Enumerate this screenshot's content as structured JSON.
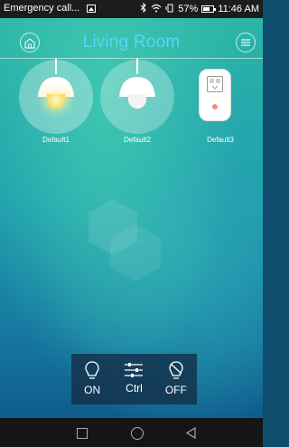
{
  "status_bar": {
    "notification_text": "Emergency call...",
    "battery_percent": "57%",
    "time": "11:46 AM",
    "icons": [
      "image-icon",
      "bluetooth-icon",
      "wifi-icon",
      "vibrate-icon",
      "battery-icon"
    ]
  },
  "header": {
    "title": "Living Room",
    "left_icon": "home-icon",
    "right_icon": "menu-icon"
  },
  "devices": [
    {
      "name": "Default1",
      "type": "lamp",
      "state": "on"
    },
    {
      "name": "Default2",
      "type": "lamp",
      "state": "off"
    },
    {
      "name": "Default3",
      "type": "smart-plug",
      "state": "off"
    }
  ],
  "controls": {
    "on_label": "ON",
    "ctrl_label": "Ctrl",
    "off_label": "OFF"
  },
  "nav_bar": {
    "buttons": [
      "recent-apps",
      "home",
      "back"
    ]
  },
  "colors": {
    "title": "#5ad4f5",
    "background_top": "#2db8a6",
    "background_bottom": "#0d5386",
    "control_panel": "#14304b"
  }
}
